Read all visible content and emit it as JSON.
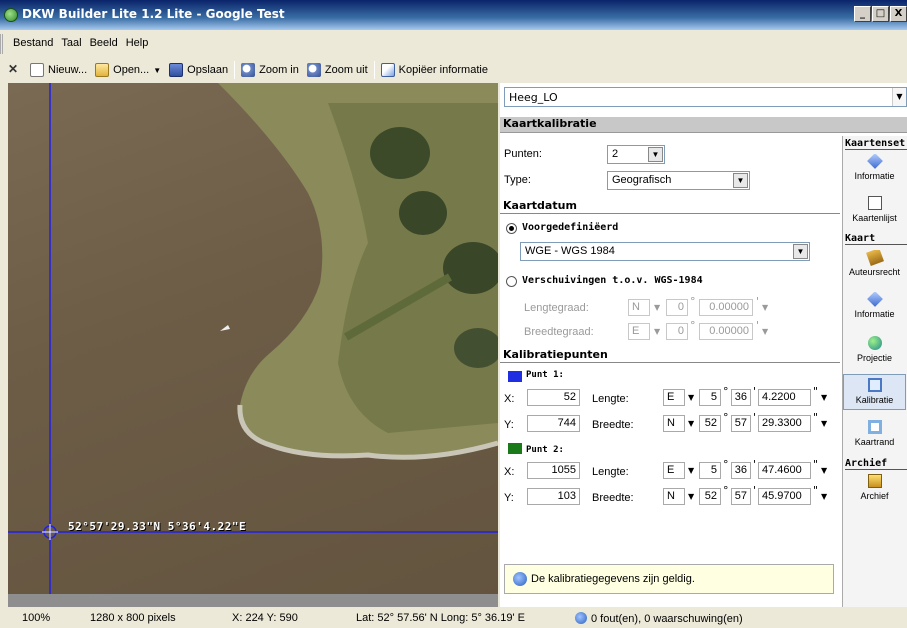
{
  "window": {
    "title": "DKW Builder Lite 1.2 Lite - Google Test",
    "min": "_",
    "max": "□",
    "close": "X"
  },
  "menu": {
    "items": [
      "Bestand",
      "Taal",
      "Beeld",
      "Help"
    ]
  },
  "toolbar": {
    "close_glyph": "✕",
    "new_label": "Nieuw...",
    "open_label": "Open...",
    "save_label": "Opslaan",
    "zoomin_label": "Zoom in",
    "zoomout_label": "Zoom uit",
    "copy_label": "Kopiëer informatie"
  },
  "map": {
    "coordinate_label": "52°57'29.33\"N 5°36'4.22\"E"
  },
  "panel": {
    "map_selector": "Heeg_LO",
    "kalibratie_header": "Kaartkalibratie",
    "punten_label": "Punten:",
    "punten_value": "2",
    "type_label": "Type:",
    "type_value": "Geografisch",
    "datum_header": "Kaartdatum",
    "predef_label": "Voorgedefiniëerd",
    "datum_value": "WGE - WGS 1984",
    "shift_label": "Verschuivingen t.o.v. WGS-1984",
    "lengte_label": "Lengtegraad:",
    "breedte_label": "Breedtegraad:",
    "shift_lon": {
      "hemi": "N",
      "deg": "0",
      "min": "0.00000"
    },
    "shift_lat": {
      "hemi": "E",
      "deg": "0",
      "min": "0.00000"
    },
    "kalibratiepunten_header": "Kalibratiepunten",
    "punt1": {
      "title": "Punt 1:",
      "color": "#1f2ee0",
      "x_label": "X:",
      "x": "52",
      "y_label": "Y:",
      "y": "744",
      "lengte_label": "Lengte:",
      "lon_hemi": "E",
      "lon_deg": "5",
      "lon_min": "36",
      "lon_sec": "4.2200",
      "breedte_label": "Breedte:",
      "lat_hemi": "N",
      "lat_deg": "52",
      "lat_min": "57",
      "lat_sec": "29.3300"
    },
    "punt2": {
      "title": "Punt 2:",
      "color": "#1a7a1a",
      "x_label": "X:",
      "x": "1055",
      "y_label": "Y:",
      "y": "103",
      "lengte_label": "Lengte:",
      "lon_hemi": "E",
      "lon_deg": "5",
      "lon_min": "36",
      "lon_sec": "47.4600",
      "breedte_label": "Breedte:",
      "lat_hemi": "N",
      "lat_deg": "52",
      "lat_min": "57",
      "lat_sec": "45.9700"
    },
    "message": "De kalibratiegegevens zijn geldig."
  },
  "rail": {
    "kaartenset_header": "Kaartenset",
    "kaart_header": "Kaart",
    "archief_header": "Archief",
    "items": {
      "informatie1": "Informatie",
      "kaartenlijst": "Kaartenlijst",
      "auteursrecht": "Auteursrecht",
      "informatie2": "Informatie",
      "projectie": "Projectie",
      "kalibratie": "Kalibratie",
      "kaartrand": "Kaartrand",
      "archief": "Archief"
    }
  },
  "status": {
    "zoom": "100%",
    "size": "1280 x 800 pixels",
    "xy": "X: 224  Y: 590",
    "latlon": "Lat: 52° 57.56' N  Long: 5° 36.19' E",
    "issues": "0 fout(en), 0 waarschuwing(en)"
  }
}
